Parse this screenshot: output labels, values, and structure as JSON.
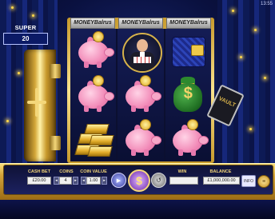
{
  "status": {
    "clock": "13:55"
  },
  "super_meter": {
    "label": "SUPER METER",
    "value": "20"
  },
  "reels": {
    "headers": [
      "MONEYBalrus",
      "MONEYBalrus",
      "MONEYBalrus"
    ],
    "columns": [
      [
        "piggy-bank",
        "piggy-bank",
        "gold-bars"
      ],
      [
        "tycoon-man",
        "piggy-bank",
        "piggy-bank"
      ],
      [
        "wallet",
        "money-bag",
        "piggy-bank"
      ]
    ]
  },
  "key_tag": {
    "text": "VAULT"
  },
  "panel": {
    "cash_bet": {
      "label": "CASH BET",
      "value": "£20.00"
    },
    "coins": {
      "label": "COINS",
      "value": "4"
    },
    "coin_value": {
      "label": "COIN VALUE",
      "value": "1.00"
    },
    "win": {
      "label": "WIN",
      "value": ""
    },
    "balance": {
      "label": "BALANCE",
      "value": "£1,000,000.00"
    }
  },
  "buttons": {
    "spin_glyph": "$",
    "autoplay_glyph": "▶",
    "max_glyph": "↺",
    "menu_glyph": "≡",
    "info_text": "INFO"
  },
  "colors": {
    "accent_gold": "#f2d57a",
    "panel_dark": "#0f1236",
    "spin_purple": "#6a26a8"
  }
}
